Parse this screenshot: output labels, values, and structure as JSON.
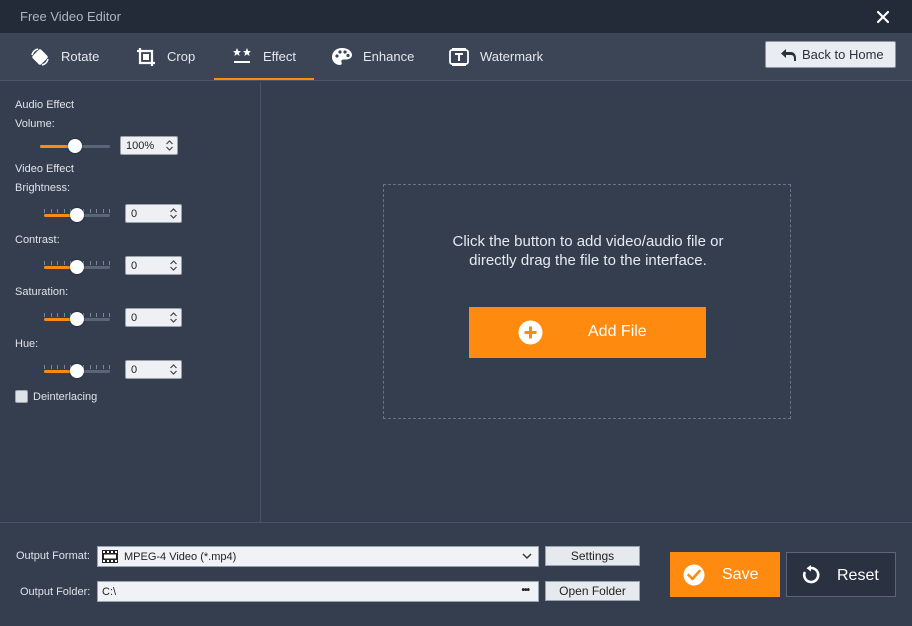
{
  "window": {
    "title": "Free Video Editor"
  },
  "toolbar": {
    "tabs": [
      {
        "label": "Rotate",
        "icon": "rotate-icon"
      },
      {
        "label": "Crop",
        "icon": "crop-icon"
      },
      {
        "label": "Effect",
        "icon": "effect-icon",
        "active": true
      },
      {
        "label": "Enhance",
        "icon": "enhance-palette-icon"
      },
      {
        "label": "Watermark",
        "icon": "watermark-icon"
      }
    ],
    "back_label": "Back to Home"
  },
  "effects": {
    "audio_heading": "Audio Effect",
    "volume_label": "Volume:",
    "volume_value": "100%",
    "video_heading": "Video Effect",
    "brightness_label": "Brightness:",
    "brightness_value": "0",
    "contrast_label": "Contrast:",
    "contrast_value": "0",
    "saturation_label": "Saturation:",
    "saturation_value": "0",
    "hue_label": "Hue:",
    "hue_value": "0",
    "deinterlacing_label": "Deinterlacing",
    "deinterlacing_checked": false
  },
  "drop_zone": {
    "line1": "Click the button to add video/audio file or",
    "line2": "directly drag the file to the interface.",
    "add_label": "Add File"
  },
  "output": {
    "format_label": "Output Format:",
    "format_value": "MPEG-4 Video (*.mp4)",
    "settings_label": "Settings",
    "folder_label": "Output Folder:",
    "folder_value": "C:\\",
    "browse_label": "•••",
    "open_folder_label": "Open Folder"
  },
  "actions": {
    "save_label": "Save",
    "reset_label": "Reset"
  },
  "colors": {
    "accent": "#ff8a10",
    "background": "#343e4f",
    "titlebar": "#232b38"
  }
}
